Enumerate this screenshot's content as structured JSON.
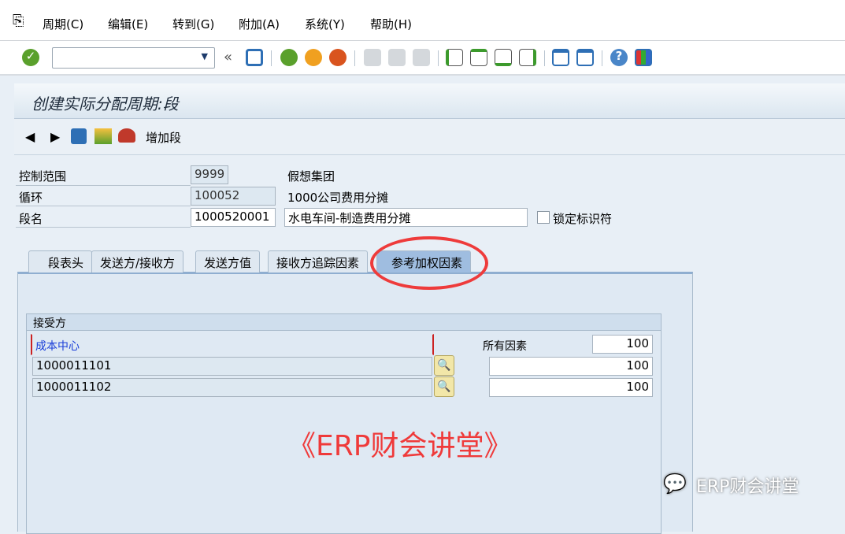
{
  "menu": {
    "items": [
      "周期(C)",
      "编辑(E)",
      "转到(G)",
      "附加(A)",
      "系统(Y)",
      "帮助(H)"
    ]
  },
  "toolbar": {
    "command_value": "",
    "icons": [
      "enter-icon",
      "back-icon",
      "save-icon",
      "exit-icon",
      "cancel-icon",
      "print-icon",
      "find-icon",
      "find-next-icon",
      "first-page-icon",
      "prev-page-icon",
      "next-page-icon",
      "last-page-icon",
      "new-session-icon",
      "shortcut-icon",
      "help-icon",
      "layout-icon"
    ]
  },
  "title": "创建实际分配周期:段",
  "apptoolbar": {
    "add_segment": "增加段"
  },
  "form": {
    "controlling_area": {
      "label": "控制范围",
      "value": "9999",
      "desc": "假想集团"
    },
    "cycle": {
      "label": "循环",
      "value": "100052",
      "desc": "1000公司费用分摊"
    },
    "segment": {
      "label": "段名",
      "value": "1000520001",
      "desc": "水电车间-制造费用分摊",
      "lock_label": "锁定标识符"
    }
  },
  "tabs": [
    "段表头",
    "发送方/接收方",
    "发送方值",
    "接收方追踪因素",
    "参考加权因素"
  ],
  "receiver": {
    "title": "接受方",
    "col_header": "成本中心",
    "all_factors_label": "所有因素",
    "all_factors_value": "100",
    "rows": [
      {
        "cost_center": "1000011101",
        "factor": "100"
      },
      {
        "cost_center": "1000011102",
        "factor": "100"
      }
    ]
  },
  "watermark": "《ERP财会讲堂》",
  "watermark2": "ERP财会讲堂"
}
